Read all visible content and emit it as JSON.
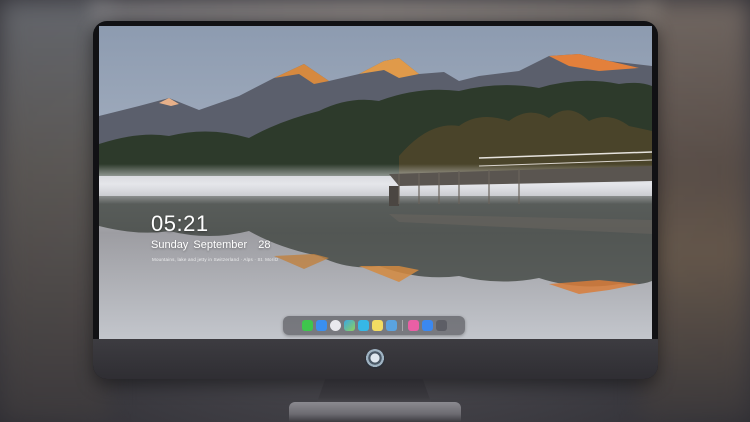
{
  "lockscreen": {
    "time": "05:21",
    "weekday": "Sunday",
    "month": "September",
    "day": "28",
    "subline": "Mountains, lake and jetty in Switzerland · Alps · St. Moritz"
  },
  "dock": {
    "apps": [
      {
        "name": "messages-icon",
        "color": "#3ec64d"
      },
      {
        "name": "finder-icon",
        "color": "#3a8ff0"
      },
      {
        "name": "safari-icon",
        "color": "#e9e9ee"
      },
      {
        "name": "photos-icon",
        "color": "#3aa8e3"
      },
      {
        "name": "clapper-icon",
        "color": "#36b7e6"
      },
      {
        "name": "notes-icon",
        "color": "#f2dc62"
      },
      {
        "name": "preview-icon",
        "color": "#5aa3e0"
      },
      {
        "name": "music-icon",
        "color": "#e95fa5"
      },
      {
        "name": "app-store-icon",
        "color": "#3b88f0"
      },
      {
        "name": "system-icon",
        "color": "#5d5e66"
      }
    ]
  },
  "colors": {
    "bezel": "#111114",
    "dock_bg": "#3c3c42"
  }
}
